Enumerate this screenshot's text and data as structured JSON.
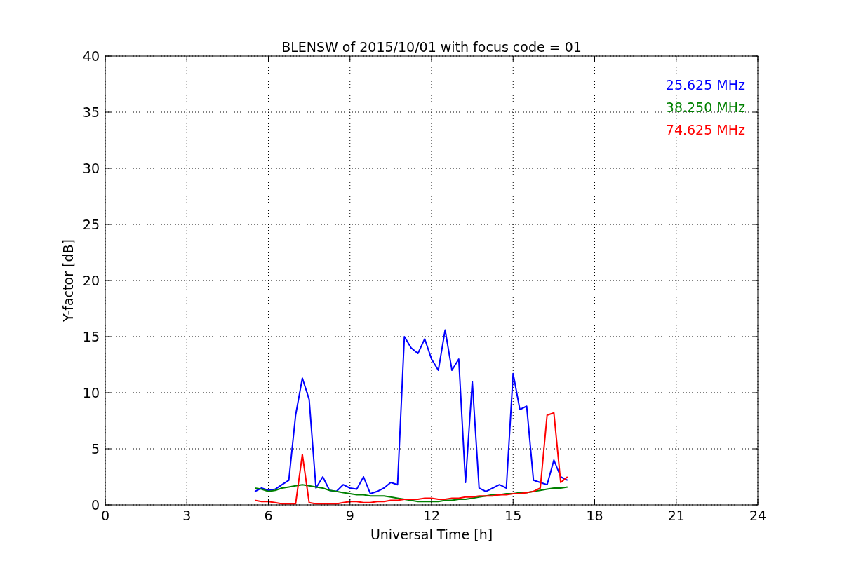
{
  "figure": {
    "chart_data": {
      "type": "line",
      "title": "BLENSW of 2015/10/01 with focus code = 01",
      "xlabel": "Universal Time [h]",
      "ylabel": "Y-factor [dB]",
      "x": [
        5.5,
        5.75,
        6,
        6.25,
        6.5,
        6.75,
        7,
        7.25,
        7.5,
        7.75,
        8,
        8.25,
        8.5,
        8.75,
        9,
        9.25,
        9.5,
        9.75,
        10,
        10.25,
        10.5,
        10.75,
        11,
        11.25,
        11.5,
        11.75,
        12,
        12.25,
        12.5,
        12.75,
        13,
        13.25,
        13.5,
        13.75,
        14,
        14.25,
        14.5,
        14.75,
        15,
        15.25,
        15.5,
        15.75,
        16,
        16.25,
        16.5,
        16.75,
        17
      ],
      "series": [
        {
          "name": "25.625 MHz",
          "color": "#0000ff",
          "values": [
            1.2,
            1.5,
            1.3,
            1.4,
            1.8,
            2.2,
            8,
            11.3,
            9.4,
            1.5,
            2.5,
            1.3,
            1.2,
            1.8,
            1.5,
            1.4,
            2.5,
            1.0,
            1.2,
            1.5,
            2.0,
            1.8,
            15,
            14,
            13.5,
            14.8,
            13,
            12,
            15.6,
            12,
            13,
            2,
            11,
            1.5,
            1.2,
            1.5,
            1.8,
            1.5,
            11.7,
            8.5,
            8.8,
            2.2,
            2,
            1.8,
            4,
            2.5,
            2.2
          ]
        },
        {
          "name": "38.250 MHz",
          "color": "#008000",
          "values": [
            1.5,
            1.4,
            1.2,
            1.3,
            1.5,
            1.6,
            1.7,
            1.8,
            1.7,
            1.6,
            1.5,
            1.3,
            1.2,
            1.1,
            1.0,
            0.9,
            0.9,
            0.8,
            0.8,
            0.8,
            0.7,
            0.6,
            0.5,
            0.4,
            0.3,
            0.3,
            0.3,
            0.3,
            0.4,
            0.4,
            0.5,
            0.5,
            0.6,
            0.7,
            0.8,
            0.9,
            0.9,
            1.0,
            1.0,
            1.1,
            1.1,
            1.2,
            1.3,
            1.4,
            1.5,
            1.5,
            1.6
          ]
        },
        {
          "name": "74.625 MHz",
          "color": "#ff0000",
          "values": [
            0.4,
            0.3,
            0.3,
            0.2,
            0.1,
            0.1,
            0.1,
            4.5,
            0.2,
            0.1,
            0.1,
            0.1,
            0.1,
            0.2,
            0.3,
            0.3,
            0.2,
            0.2,
            0.3,
            0.3,
            0.4,
            0.4,
            0.5,
            0.5,
            0.5,
            0.6,
            0.6,
            0.5,
            0.5,
            0.6,
            0.6,
            0.7,
            0.7,
            0.8,
            0.8,
            0.8,
            0.9,
            0.9,
            1.0,
            1.0,
            1.1,
            1.2,
            1.5,
            8.0,
            8.2,
            2.0,
            2.5
          ]
        }
      ],
      "grid": true,
      "xlim": [
        0,
        24
      ],
      "ylim": [
        0,
        40
      ],
      "xticks": [
        0,
        3,
        6,
        9,
        12,
        15,
        18,
        21,
        24
      ],
      "yticks": [
        0,
        5,
        10,
        15,
        20,
        25,
        30,
        35,
        40
      ]
    }
  }
}
